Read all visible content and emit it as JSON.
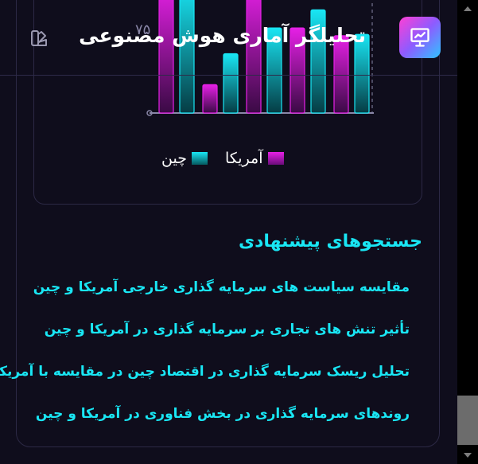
{
  "header": {
    "title": "تحلیلگر آماری هوش مصنوعی",
    "app_icon": "presentation-chart-icon",
    "theme_icon": "theme-palette-icon"
  },
  "chart_data": {
    "type": "bar",
    "y_tick_visible": "۷۵",
    "legend_position": "bottom",
    "ylim": [
      0,
      100
    ],
    "series": [
      {
        "name": "آمریکا",
        "color": "#e620e6",
        "values": [
          100,
          22,
          100,
          66,
          60
        ]
      },
      {
        "name": "چین",
        "color": "#19e6f4",
        "values": [
          100,
          46,
          66,
          80,
          61
        ]
      }
    ],
    "legend": {
      "series1": "آمریکا",
      "series2": "چین"
    }
  },
  "suggestions": {
    "title": "جستجوهای پیشنهادی",
    "items": [
      "مقایسه سیاست های سرمایه گذاری خارجی آمریکا و چین",
      "تأثیر تنش های تجاری بر سرمایه گذاری در آمریکا و چین",
      "تحلیل ریسک سرمایه گذاری در اقتصاد چین در مقایسه با آمریکا",
      "روندهای سرمایه گذاری در بخش فناوری در آمریکا و چین"
    ]
  },
  "colors": {
    "background": "#0f0d1c",
    "accent_cyan": "#19e6f4",
    "accent_magenta": "#e620e6",
    "card_border": "#2c2945"
  }
}
